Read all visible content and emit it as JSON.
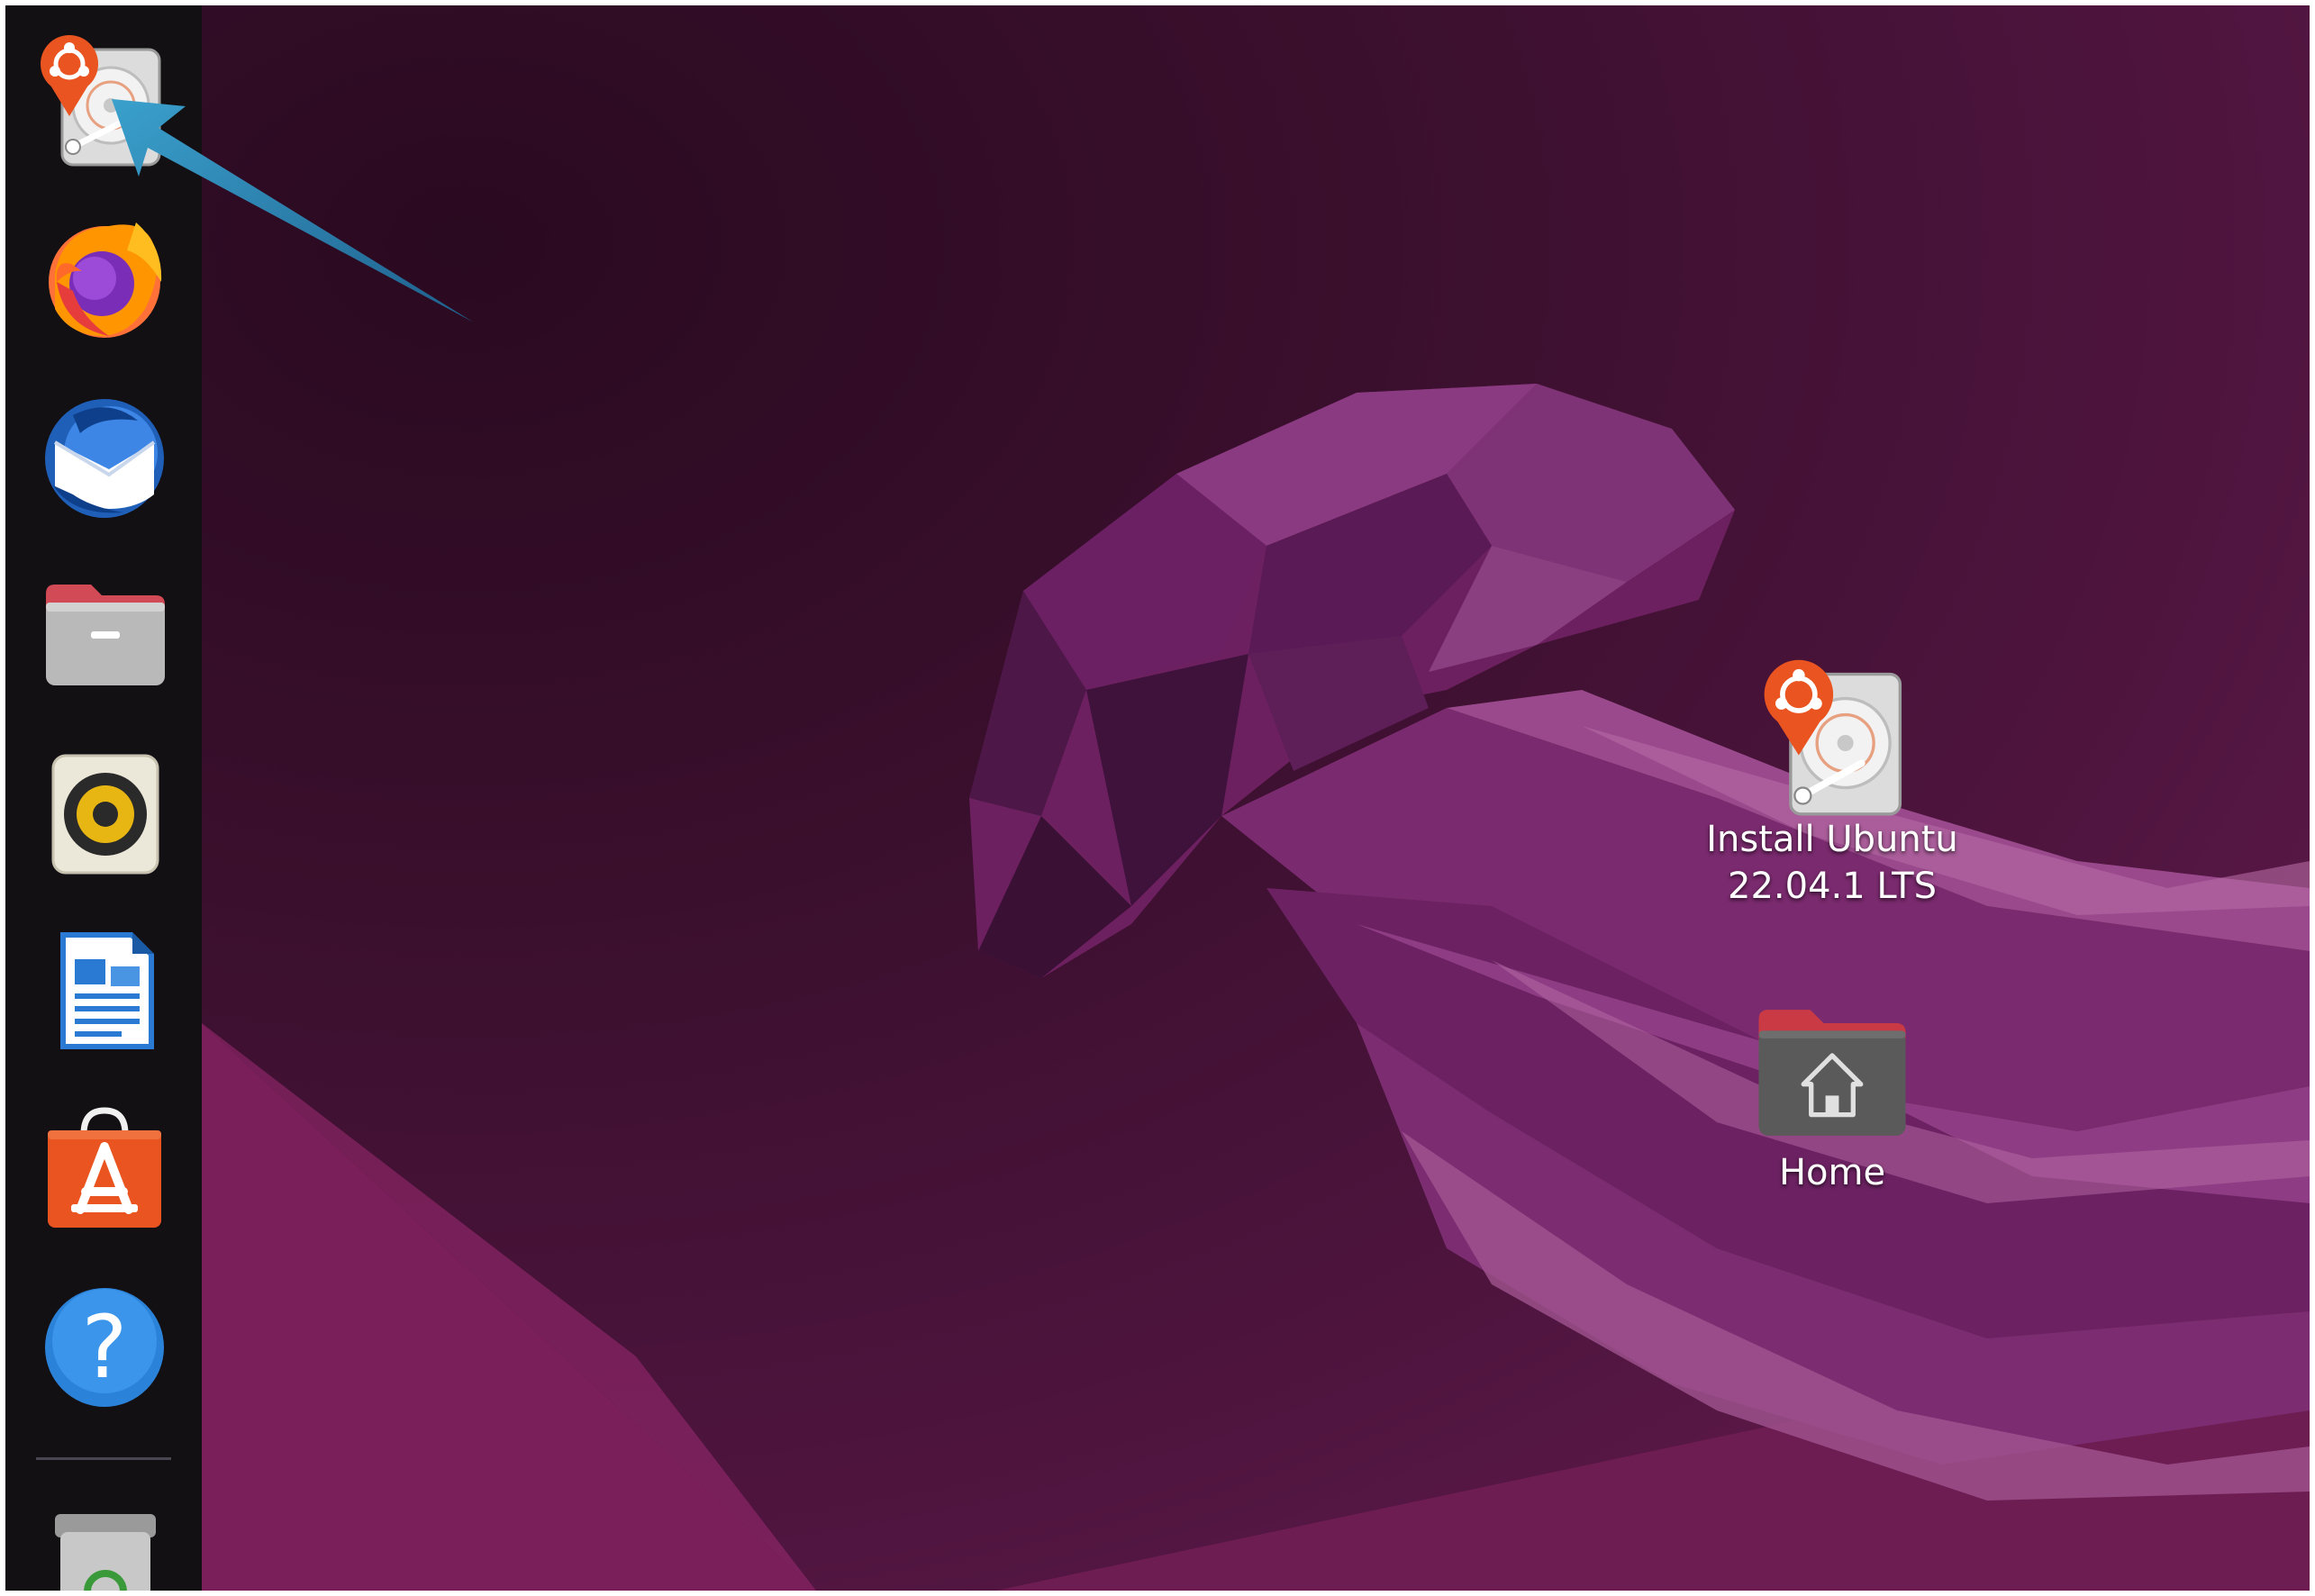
{
  "dock": {
    "items": [
      {
        "name": "install-ubuntu",
        "icon": "installer-disk-icon"
      },
      {
        "name": "firefox",
        "icon": "firefox-icon"
      },
      {
        "name": "thunderbird",
        "icon": "thunderbird-icon"
      },
      {
        "name": "files",
        "icon": "folder-icon"
      },
      {
        "name": "rhythmbox",
        "icon": "speaker-icon"
      },
      {
        "name": "libreoffice-writer",
        "icon": "document-icon"
      },
      {
        "name": "ubuntu-software",
        "icon": "software-bag-icon"
      },
      {
        "name": "help",
        "icon": "help-icon"
      },
      {
        "name": "trash",
        "icon": "trash-icon"
      }
    ]
  },
  "desktop": {
    "install_label": "Install Ubuntu\n22.04.1 LTS",
    "home_label": "Home"
  },
  "colors": {
    "dock_bg": "#131014",
    "ubuntu_orange": "#e95420",
    "annotation_arrow": "#2c7fa8"
  }
}
